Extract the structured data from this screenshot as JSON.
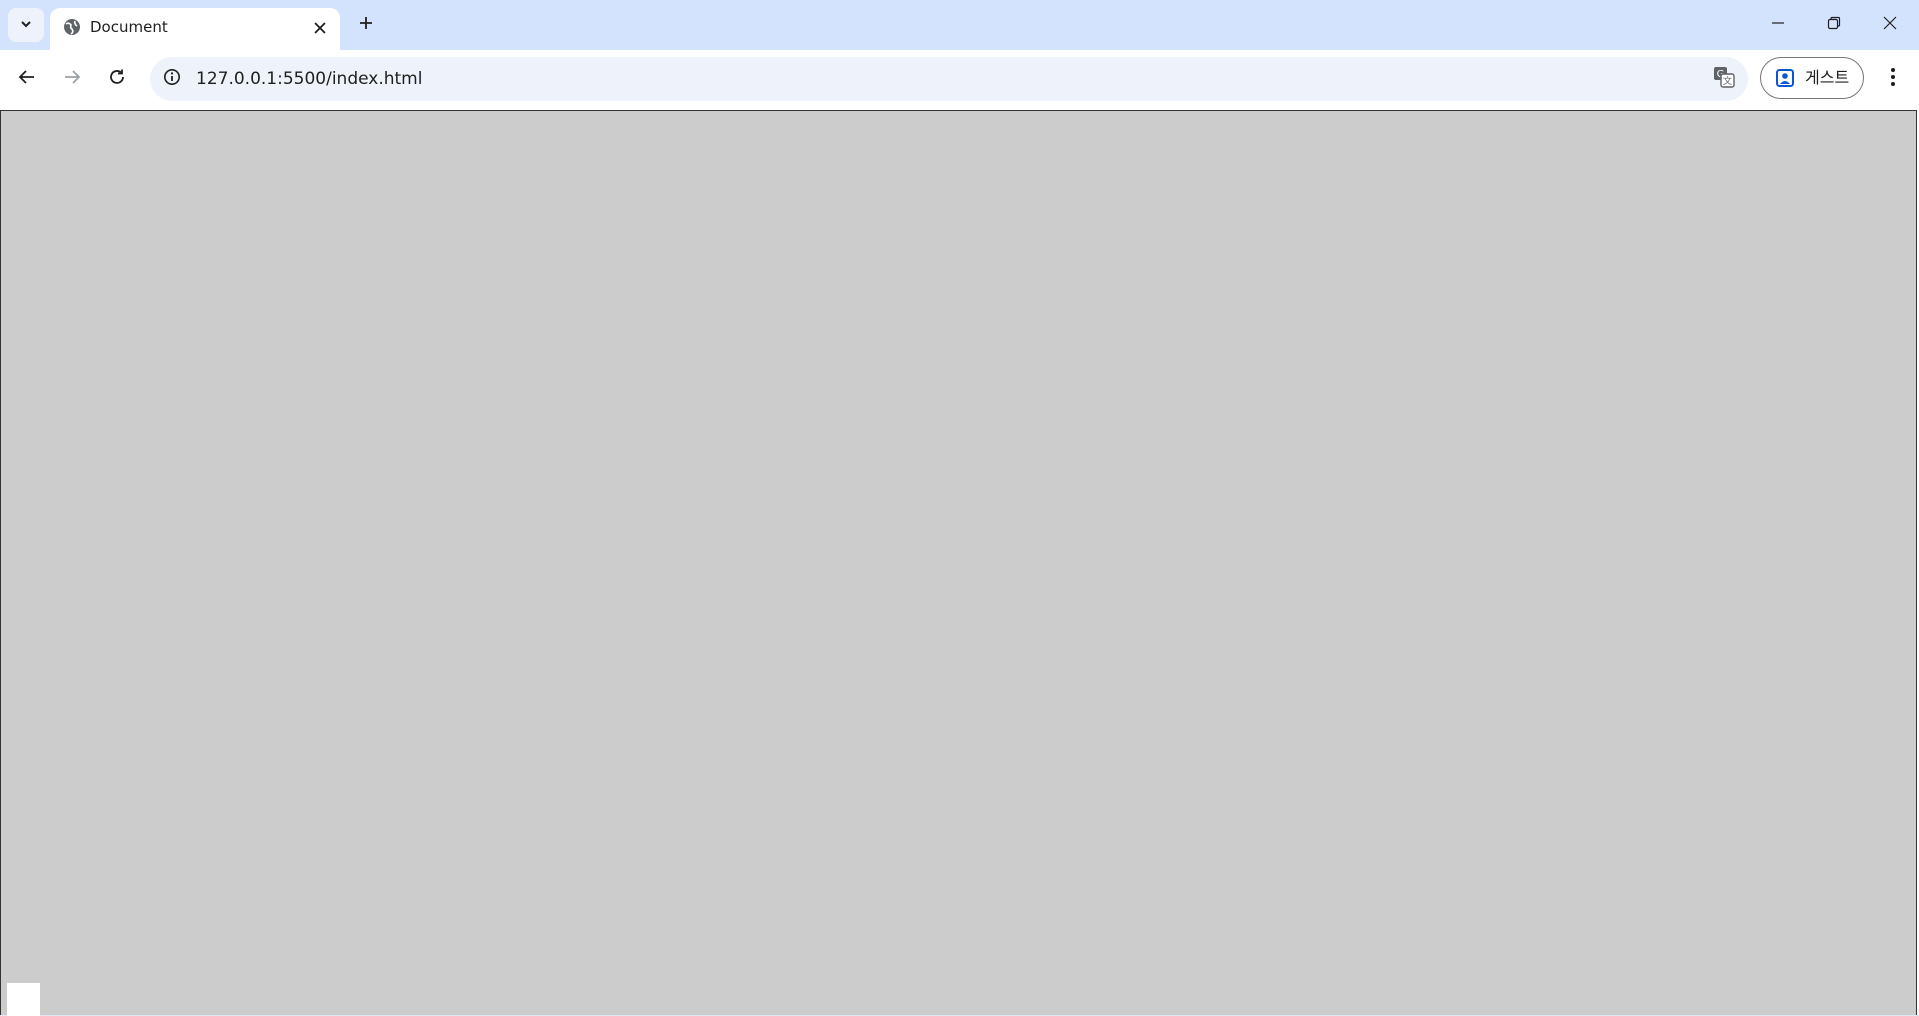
{
  "browser": {
    "tab": {
      "title": "Document"
    },
    "address_bar": {
      "url": "127.0.0.1:5500/index.html"
    },
    "profile": {
      "label": "게스트"
    }
  },
  "page": {
    "canvas_color": "#cccccc",
    "box_color": "#ffffff"
  },
  "icons": {
    "tab_search": "chevron-down-icon",
    "favicon": "globe-icon",
    "tab_close": "close-icon",
    "new_tab": "plus-icon",
    "minimize": "minimize-icon",
    "restore": "restore-icon",
    "close_window": "close-icon",
    "back": "arrow-left-icon",
    "forward": "arrow-right-icon",
    "reload": "reload-icon",
    "site_info": "info-icon",
    "translate": "translate-icon",
    "profile": "person-icon",
    "menu": "kebab-menu-icon"
  }
}
